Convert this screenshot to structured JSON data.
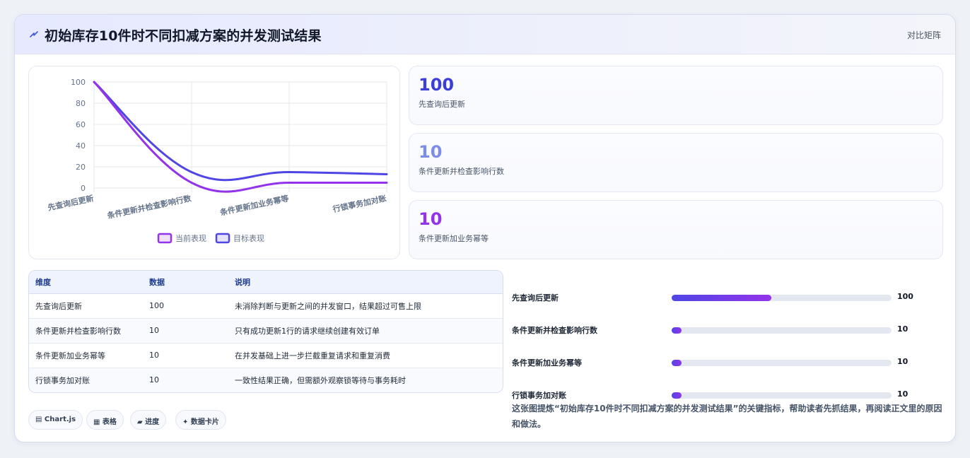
{
  "header": {
    "title": "初始库存10件时不同扣减方案的并发测试结果",
    "icon": "lightning-icon",
    "right_label": "对比矩阵"
  },
  "chart_data": {
    "type": "line",
    "categories": [
      "先查询后更新",
      "条件更新并检查影响行数",
      "条件更新加业务幂等",
      "行锁事务加对账"
    ],
    "series": [
      {
        "name": "当前表现",
        "values": [
          100,
          5,
          5,
          5
        ],
        "color": "#9333ea"
      },
      {
        "name": "目标表现",
        "values": [
          100,
          15,
          15,
          13
        ],
        "color": "#4f46e5"
      }
    ],
    "ylim": [
      0,
      100
    ],
    "yticks": [
      0,
      20,
      40,
      60,
      80,
      100
    ],
    "grid": true,
    "legend": "bottom"
  },
  "stats": [
    {
      "value": "100",
      "label": "先查询后更新",
      "color": "#3b3fd8"
    },
    {
      "value": "10",
      "label": "条件更新并检查影响行数",
      "color": "#7c8de8"
    },
    {
      "value": "10",
      "label": "条件更新加业务幂等",
      "color": "#9333ea"
    }
  ],
  "table": {
    "headers": [
      "维度",
      "数据",
      "说明"
    ],
    "rows": [
      [
        "先查询后更新",
        "100",
        "未消除判断与更新之间的并发窗口，结果超过可售上限"
      ],
      [
        "条件更新并检查影响行数",
        "10",
        "只有成功更新1行的请求继续创建有效订单"
      ],
      [
        "条件更新加业务幂等",
        "10",
        "在并发基础上进一步拦截重复请求和重复消费"
      ],
      [
        "行锁事务加对账",
        "10",
        "一致性结果正确，但需额外观察锁等待与事务耗时"
      ]
    ]
  },
  "progress": {
    "max": 220,
    "items": [
      {
        "label": "先查询后更新",
        "value": "100",
        "num": 100
      },
      {
        "label": "条件更新并检查影响行数",
        "value": "10",
        "num": 10
      },
      {
        "label": "条件更新加业务幂等",
        "value": "10",
        "num": 10
      },
      {
        "label": "行锁事务加对账",
        "value": "10",
        "num": 10
      }
    ]
  },
  "tags": [
    "▤ Chart.js",
    "▦ 表格",
    "▰ 进度",
    "✦ 数据卡片"
  ],
  "description": "这张图提炼“初始库存10件时不同扣减方案的并发测试结果”的关键指标，帮助读者先抓结果，再阅读正文里的原因和做法。"
}
